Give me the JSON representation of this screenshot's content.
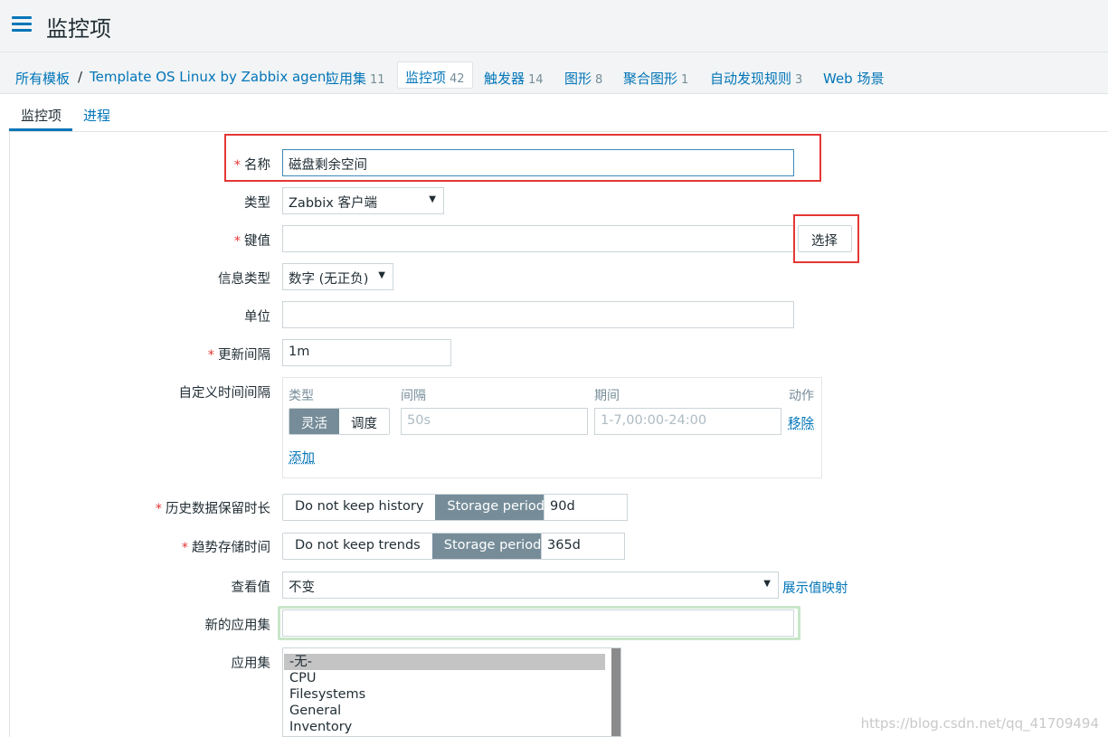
{
  "header": {
    "title": "监控项"
  },
  "breadcrumb": {
    "all_templates": "所有模板",
    "separator": "/",
    "template": "Template OS Linux by Zabbix agent",
    "items": [
      {
        "label": "应用集",
        "count": "11"
      },
      {
        "label": "监控项",
        "count": "42"
      },
      {
        "label": "触发器",
        "count": "14"
      },
      {
        "label": "图形",
        "count": "8"
      },
      {
        "label": "聚合图形",
        "count": "1"
      },
      {
        "label": "自动发现规则",
        "count": "3"
      },
      {
        "label": "Web 场景",
        "count": ""
      }
    ]
  },
  "tabs": [
    {
      "label": "监控项"
    },
    {
      "label": "进程"
    }
  ],
  "form": {
    "name": {
      "label": "名称",
      "value": "磁盘剩余空间"
    },
    "type": {
      "label": "类型",
      "value": "Zabbix 客户端"
    },
    "key": {
      "label": "键值",
      "value": "",
      "button": "选择"
    },
    "info_type": {
      "label": "信息类型",
      "value": "数字 (无正负)"
    },
    "units": {
      "label": "单位",
      "value": ""
    },
    "update_interval": {
      "label": "更新间隔",
      "value": "1m"
    },
    "custom_intervals": {
      "label": "自定义时间间隔",
      "col_type": "类型",
      "col_interval": "间隔",
      "col_period": "期间",
      "col_action": "动作",
      "opt_flexible": "灵活",
      "opt_scheduling": "调度",
      "interval_placeholder": "50s",
      "period_placeholder": "1-7,00:00-24:00",
      "remove": "移除",
      "add": "添加"
    },
    "history": {
      "label": "历史数据保留时长",
      "opt_no": "Do not keep history",
      "opt_period": "Storage period",
      "value": "90d"
    },
    "trends": {
      "label": "趋势存储时间",
      "opt_no": "Do not keep trends",
      "opt_period": "Storage period",
      "value": "365d"
    },
    "show_value": {
      "label": "查看值",
      "value": "不变",
      "link": "展示值映射"
    },
    "new_application": {
      "label": "新的应用集",
      "value": ""
    },
    "applications": {
      "label": "应用集",
      "options": [
        "-无-",
        "CPU",
        "Filesystems",
        "General",
        "Inventory"
      ]
    }
  },
  "watermark": "https://blog.csdn.net/qq_41709494",
  "colors": {
    "accent": "#0275b8",
    "required": "#e33734",
    "highlight_box": "#e33734",
    "segment_on": "#768d99"
  }
}
